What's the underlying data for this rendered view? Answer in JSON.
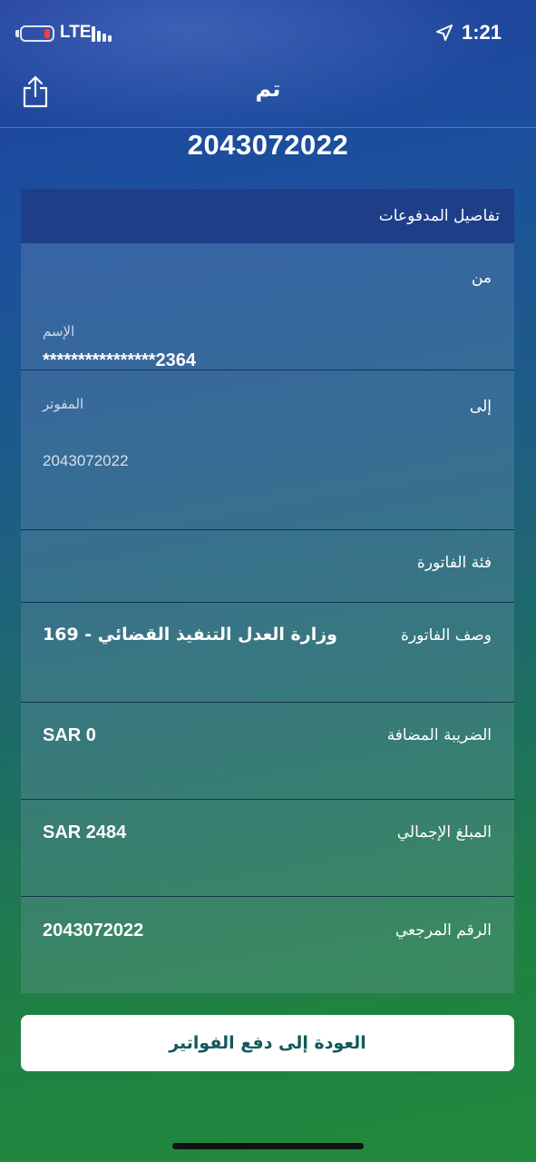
{
  "status_bar": {
    "network": "LTE",
    "time": "1:21"
  },
  "nav": {
    "title": "تم",
    "share_icon": "share-icon"
  },
  "reference_heading": "2043072022",
  "card": {
    "title": "تفاصيل المدفوعات",
    "from": {
      "label": "من",
      "sub_label": "الإسم",
      "value": "****************2364"
    },
    "to": {
      "label": "إلى",
      "sub_label": "المفوتر",
      "value": "2043072022"
    },
    "bill_category": {
      "label": "فئة الفاتورة",
      "value": ""
    },
    "bill_description": {
      "label": "وصف الفاتورة",
      "value": "169 - وزارة العدل التنفيذ القضائي"
    },
    "vat": {
      "label": "الضريبة المضافة",
      "value": "SAR 0"
    },
    "total_amount": {
      "label": "المبلغ الإجمالي",
      "value": "SAR 2484"
    },
    "reference_number": {
      "label": "الرقم المرجعي",
      "value": "2043072022"
    }
  },
  "back_button_label": "العودة إلى دفع الفواتير",
  "colors": {
    "header": "#1e3f88",
    "button_text": "#14595c",
    "battery_low": "#ff3b30"
  }
}
